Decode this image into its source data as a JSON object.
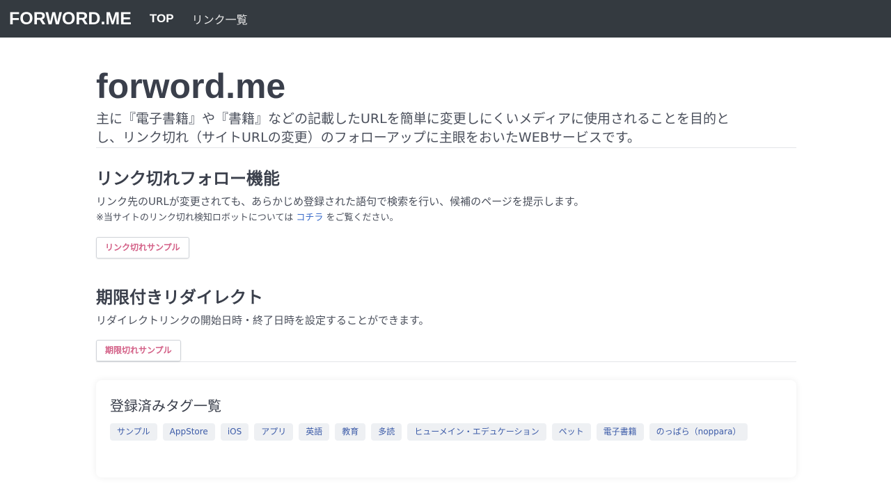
{
  "navbar": {
    "brand": "FORWORD.ME",
    "items": [
      {
        "label": "TOP"
      },
      {
        "label": "リンク一覧"
      }
    ]
  },
  "hero": {
    "title": "forword.me",
    "lead_line1": "主に『電子書籍』や『書籍』などの記載したURLを簡単に変更しにくいメディアに使用されることを目的と",
    "lead_line2": "し、リンク切れ（サイトURLの変更）のフォローアップに主眼をおいたWEBサービスです。"
  },
  "feature_link_follow": {
    "title": "リンク切れフォロー機能",
    "description": "リンク先のURLが変更されても、あらかじめ登録された語句で検索を行い、候補のページを提示します。",
    "note_prefix": "※当サイトのリンク切れ検知ロボットについては",
    "note_link": "コチラ",
    "note_suffix": "をご覧ください。",
    "button_label": "リンク切れサンプル"
  },
  "feature_redirect": {
    "title": "期限付きリダイレクト",
    "description": "リダイレクトリンクの開始日時・終了日時を設定することができます。",
    "button_label": "期限切れサンプル"
  },
  "tags": {
    "title": "登録済みタグ一覧",
    "items": [
      "サンプル",
      "AppStore",
      "iOS",
      "アプリ",
      "英語",
      "教育",
      "多読",
      "ヒューメイン・エデュケーション",
      "ペット",
      "電子書籍",
      "のっぱら（noppara）"
    ]
  }
}
